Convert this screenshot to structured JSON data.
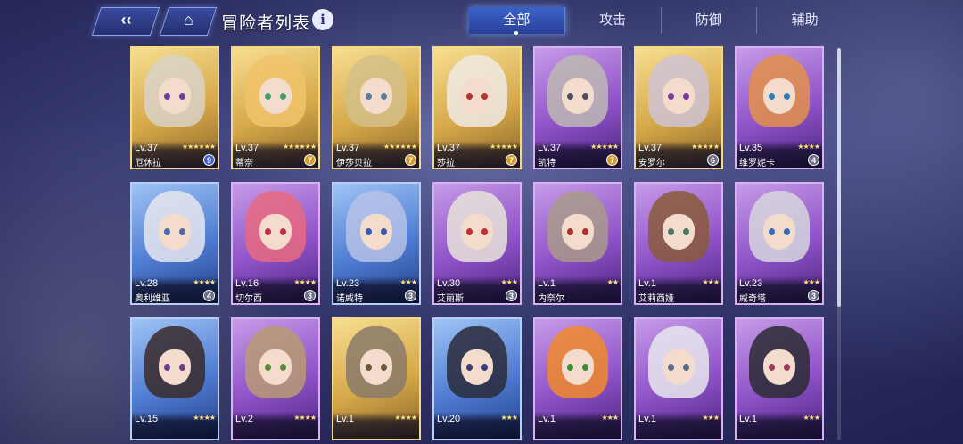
{
  "header": {
    "back_icon": "back-arrow-icon",
    "home_icon": "home-icon",
    "title": "冒险者列表",
    "info_label": "i"
  },
  "tabs": [
    {
      "label": "全部",
      "active": true
    },
    {
      "label": "攻击",
      "active": false
    },
    {
      "label": "防御",
      "active": false
    },
    {
      "label": "辅助",
      "active": false
    }
  ],
  "colors": {
    "gold": "#f5d98a",
    "purple": "#c79be8",
    "blue": "#9fc4f5",
    "badge_blue": "#3a5ed0",
    "badge_gold": "#d19a2a",
    "badge_gray": "#6b6f85"
  },
  "cards": [
    {
      "level": "Lv.37",
      "name": "厄休拉",
      "stars": "★★★★★★",
      "badge": "9",
      "rarity": "gold",
      "badge_color": "blue",
      "hair": "#d9d2c7",
      "eye": "#6a3fa0"
    },
    {
      "level": "Lv.37",
      "name": "蒂奈",
      "stars": "★★★★★★",
      "badge": "7",
      "rarity": "gold",
      "badge_color": "gold",
      "hair": "#f1c36b",
      "eye": "#3fa06a"
    },
    {
      "level": "Lv.37",
      "name": "伊莎贝拉",
      "stars": "★★★★★★",
      "badge": "7",
      "rarity": "gold",
      "badge_color": "gold",
      "hair": "#d3c08a",
      "eye": "#5a7a9a"
    },
    {
      "level": "Lv.37",
      "name": "莎拉",
      "stars": "★★★★★",
      "badge": "7",
      "rarity": "gold",
      "badge_color": "gold",
      "hair": "#efeae4",
      "eye": "#b4332c"
    },
    {
      "level": "Lv.37",
      "name": "凯特",
      "stars": "★★★★★",
      "badge": "7",
      "rarity": "purple",
      "badge_color": "gold",
      "hair": "#bdb8b4",
      "eye": "#4a4a60"
    },
    {
      "level": "Lv.37",
      "name": "安罗尔",
      "stars": "★★★★★",
      "badge": "6",
      "rarity": "gold",
      "badge_color": "gray",
      "hair": "#cfc3d6",
      "eye": "#7a3aa0"
    },
    {
      "level": "Lv.35",
      "name": "维罗妮卡",
      "stars": "★★★★",
      "badge": "4",
      "rarity": "purple",
      "badge_color": "gray",
      "hair": "#e4904a",
      "eye": "#2f7ab8"
    },
    {
      "level": "Lv.28",
      "name": "奥利维亚",
      "stars": "★★★★",
      "badge": "4",
      "rarity": "blue",
      "badge_color": "gray",
      "hair": "#e6e6ef",
      "eye": "#4a6ab0"
    },
    {
      "level": "Lv.16",
      "name": "切尔西",
      "stars": "★★★★",
      "badge": "3",
      "rarity": "purple",
      "badge_color": "gray",
      "hair": "#e86a80",
      "eye": "#c0304a"
    },
    {
      "level": "Lv.23",
      "name": "诺威特",
      "stars": "★★★",
      "badge": "3",
      "rarity": "blue",
      "badge_color": "gray",
      "hair": "#b6c2e8",
      "eye": "#3a5ab0"
    },
    {
      "level": "Lv.30",
      "name": "艾丽斯",
      "stars": "★★★",
      "badge": "3",
      "rarity": "purple",
      "badge_color": "gray",
      "hair": "#e8e3da",
      "eye": "#c03030"
    },
    {
      "level": "Lv.1",
      "name": "内奈尔",
      "stars": "★★",
      "badge": "",
      "rarity": "purple",
      "badge_color": "gray",
      "hair": "#a99a8a",
      "eye": "#b03030"
    },
    {
      "level": "Lv.1",
      "name": "艾莉西娅",
      "stars": "★★★",
      "badge": "",
      "rarity": "purple",
      "badge_color": "gray",
      "hair": "#8a5a3a",
      "eye": "#4a7a60"
    },
    {
      "level": "Lv.23",
      "name": "威奇塔",
      "stars": "★★★",
      "badge": "3",
      "rarity": "purple",
      "badge_color": "gray",
      "hair": "#d6d6de",
      "eye": "#3a6ab8"
    },
    {
      "level": "Lv.15",
      "name": "",
      "stars": "★★★★",
      "badge": "",
      "rarity": "blue",
      "badge_color": "gray",
      "hair": "#3a2a2a",
      "eye": "#6a3a8a"
    },
    {
      "level": "Lv.2",
      "name": "",
      "stars": "★★★★",
      "badge": "",
      "rarity": "purple",
      "badge_color": "gray",
      "hair": "#b89a72",
      "eye": "#5a8a3a"
    },
    {
      "level": "Lv.1",
      "name": "",
      "stars": "★★★★",
      "badge": "",
      "rarity": "gold",
      "badge_color": "gray",
      "hair": "#8a7a6a",
      "eye": "#6a5a3a"
    },
    {
      "level": "Lv.20",
      "name": "",
      "stars": "★★★",
      "badge": "",
      "rarity": "blue",
      "badge_color": "gray",
      "hair": "#2a2a3a",
      "eye": "#3a3a7a"
    },
    {
      "level": "Lv.1",
      "name": "",
      "stars": "★★★",
      "badge": "",
      "rarity": "purple",
      "badge_color": "gray",
      "hair": "#f08a2a",
      "eye": "#3a8a3a"
    },
    {
      "level": "Lv.1",
      "name": "",
      "stars": "★★★",
      "badge": "",
      "rarity": "purple",
      "badge_color": "gray",
      "hair": "#e8e8ee",
      "eye": "#5a6a8a"
    },
    {
      "level": "Lv.1",
      "name": "",
      "stars": "★★★",
      "badge": "",
      "rarity": "purple",
      "badge_color": "gray",
      "hair": "#2a2a34",
      "eye": "#a03a5a"
    }
  ]
}
